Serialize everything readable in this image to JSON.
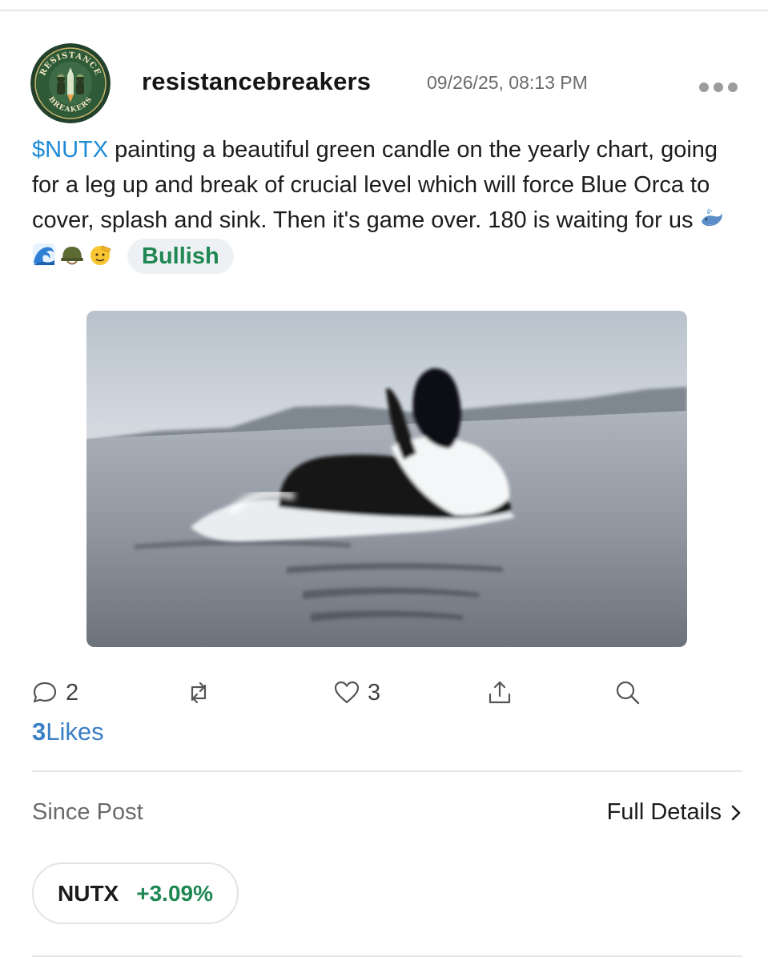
{
  "post": {
    "avatar": {
      "icon": "resistance-breakers-logo",
      "top_text": "RESISTANCE",
      "bottom_text": "BREAKERS"
    },
    "username": "resistancebreakers",
    "timestamp": "09/26/25, 08:13 PM",
    "more_icon": "more-horizontal-icon",
    "body": {
      "cashtag": "$NUTX",
      "text": " painting a beautiful green candle on the yearly chart, going for a leg up and break of crucial level which will force Blue Orca to cover, splash and sink. Then it's game over. 180 is waiting for us ",
      "emojis": [
        "whale",
        "water-wave",
        "military-helmet",
        "saluting-face"
      ],
      "sentiment": "Bullish"
    },
    "image": {
      "subject": "orca-breaching-photo"
    }
  },
  "actions": {
    "comment": {
      "icon": "comment-icon",
      "count": "2"
    },
    "repost": {
      "icon": "repost-icon"
    },
    "like": {
      "icon": "heart-icon",
      "count": "3"
    },
    "share": {
      "icon": "share-icon"
    },
    "search": {
      "icon": "search-icon"
    }
  },
  "likes_summary": {
    "count": "3",
    "label": "Likes"
  },
  "performance": {
    "since_label": "Since Post",
    "details_label": "Full Details",
    "ticker": "NUTX",
    "change": "+3.09%"
  },
  "colors": {
    "cashtag": "#1d8ad6",
    "bullish": "#1f8752",
    "likes_link": "#3b7fc4"
  }
}
